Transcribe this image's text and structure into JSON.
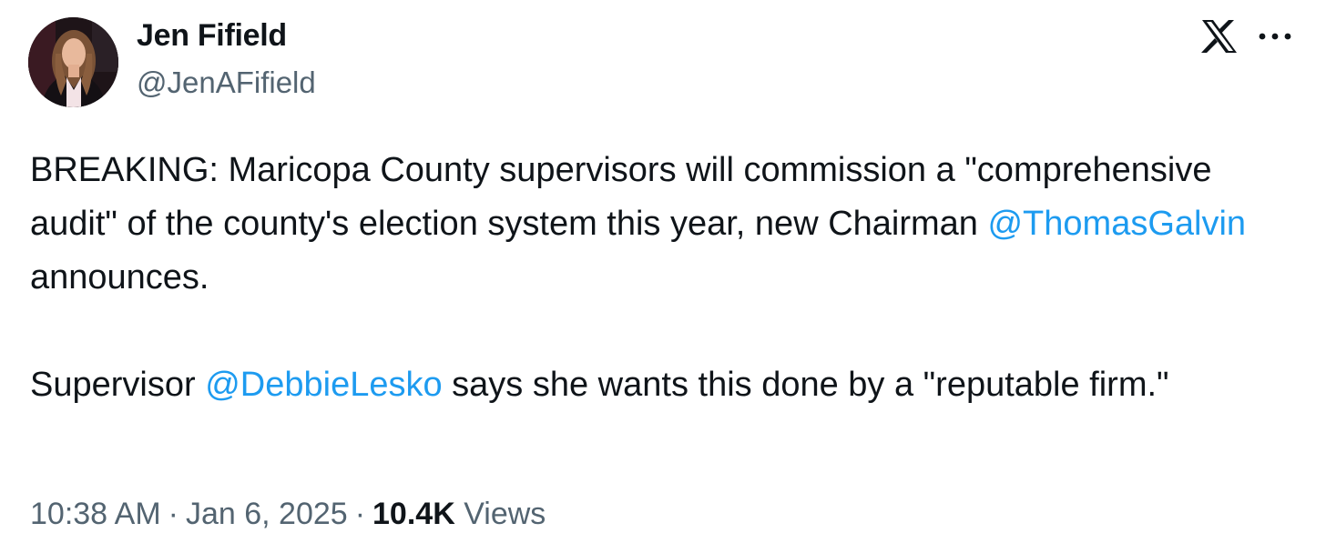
{
  "author": {
    "name": "Jen Fifield",
    "handle": "@JenAFifield",
    "avatar_icon": "profile-photo"
  },
  "header": {
    "logo_icon": "x-logo-icon",
    "more_icon": "more-options-icon"
  },
  "tweet": {
    "paragraph1": {
      "before": "BREAKING: Maricopa County supervisors will commission a \"comprehensive audit\" of the county's election system this year, new Chairman ",
      "mention": "@ThomasGalvin",
      "after": " announces."
    },
    "paragraph2": {
      "before": "Supervisor ",
      "mention": "@DebbieLesko",
      "after": " says she wants this done by a \"reputable firm.\""
    }
  },
  "meta": {
    "time": "10:38 AM",
    "date": "Jan 6, 2025",
    "separator": "·",
    "views_count": "10.4K",
    "views_label": "Views"
  },
  "colors": {
    "text": "#0f1419",
    "secondary": "#536471",
    "link": "#1d9bf0",
    "background": "#ffffff"
  }
}
